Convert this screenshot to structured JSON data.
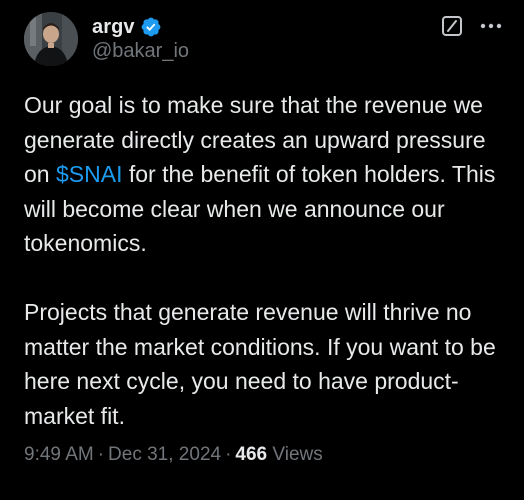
{
  "author": {
    "display_name": "argv",
    "handle": "@bakar_io",
    "verified": true
  },
  "header_actions": {
    "grok_icon": "grok-slash-icon",
    "more_icon": "more-horizontal-icon"
  },
  "tweet": {
    "paragraph1_before": "Our goal is to make sure that the revenue we generate directly creates an upward pressure on ",
    "cashtag": "$SNAI",
    "paragraph1_after": " for the benefit of token holders. This will become clear when we announce our tokenomics.",
    "paragraph2": "Projects that generate revenue will thrive no matter the market conditions. If you want to be here next cycle, you need to have product-market fit."
  },
  "meta": {
    "time": "9:49 AM",
    "separator": "·",
    "date": "Dec 31, 2024",
    "views_count": "466",
    "views_label": "Views"
  },
  "colors": {
    "background": "#000000",
    "text": "#e7e9ea",
    "secondary": "#71767b",
    "accent": "#1d9bf0"
  }
}
